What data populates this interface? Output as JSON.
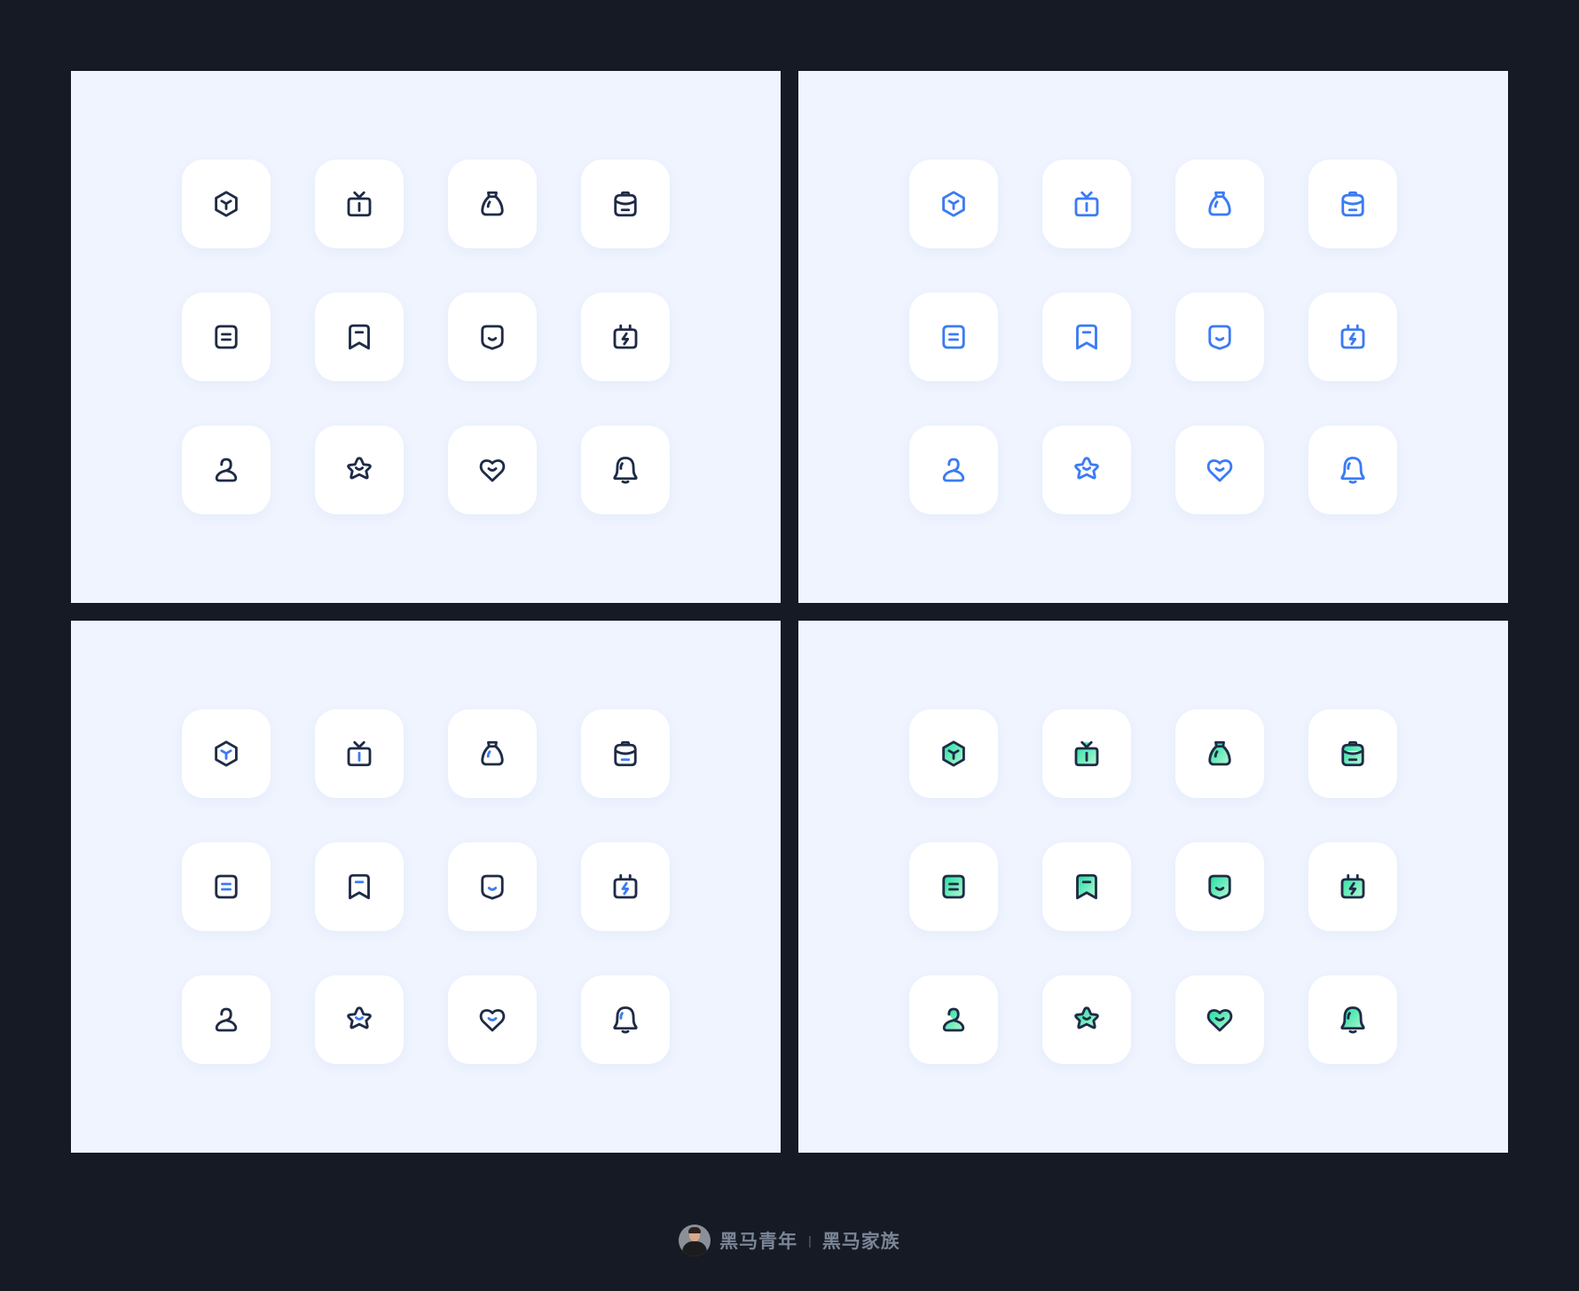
{
  "colors": {
    "background": "#161a24",
    "panel": "#eff4ff",
    "tile": "#ffffff",
    "dark_navy": "#1f2b46",
    "accent_blue": "#3b7bf5",
    "gradient_green_start": "#1ee0a0",
    "gradient_green_end": "#b8f7d4"
  },
  "panels": [
    {
      "style": "dark-outline"
    },
    {
      "style": "blue-outline"
    },
    {
      "style": "two-tone-dark-blue"
    },
    {
      "style": "dark-outline-green-gradient-fill"
    }
  ],
  "icons": [
    "cube-icon",
    "tv-icon",
    "money-bag-icon",
    "backpack-icon",
    "document-icon",
    "bookmark-icon",
    "shield-smile-icon",
    "battery-charge-icon",
    "user-icon",
    "star-smile-icon",
    "heart-smile-icon",
    "bell-icon"
  ],
  "footer": {
    "left_text": "黑马青年",
    "separator": "|",
    "right_text": "黑马家族"
  }
}
